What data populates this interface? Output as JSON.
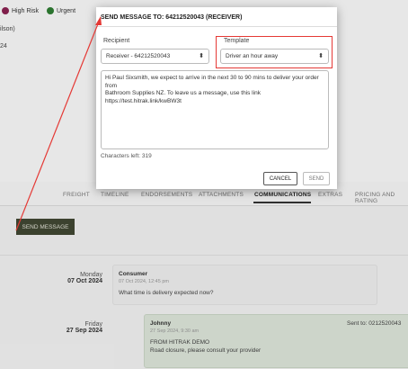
{
  "background": {
    "badges": [
      {
        "label": "High Risk",
        "color": "#8b2252"
      },
      {
        "label": "Urgent",
        "color": "#2e7d32"
      }
    ],
    "left_fragments": [
      "ilson)",
      "24"
    ],
    "tabs": [
      "FREIGHT",
      "TIMELINE",
      "ENDORSEMENTS",
      "ATTACHMENTS",
      "COMMUNICATIONS",
      "EXTRAS",
      "PRICING AND RATING"
    ],
    "active_tab": "COMMUNICATIONS",
    "send_message_button": "SEND MESSAGE",
    "messages": [
      {
        "day": "Monday",
        "date": "07 Oct 2024",
        "sender": "Consumer",
        "time": "07 Oct 2024, 12:45 pm",
        "text": "What time is delivery expected now?"
      },
      {
        "day": "Friday",
        "date": "27 Sep 2024",
        "sender": "Johnny",
        "time": "27 Sep 2024, 9:30 am",
        "sent_to": "Sent to: 0212520043",
        "text": "FROM HITRAK DEMO",
        "text2": "Road closure, please consult your provider"
      }
    ]
  },
  "modal": {
    "title": "SEND MESSAGE TO: 64212520043 (RECEIVER)",
    "recipient_label": "Recipient",
    "recipient_value": "Receiver - 64212520043",
    "template_label": "Template",
    "template_value": "Driver an hour away",
    "message_line1": "Hi Paul Sixsmith, we expect to arrive in the next 30 to 90 mins to deliver your order from",
    "message_line2": "Bathroom Supplies NZ. To leave us a message, use this link",
    "message_line3": "https://test.hitrak.link/kwBW3t",
    "characters_left": "Characters left: 319",
    "cancel_label": "CANCEL",
    "send_label": "SEND"
  },
  "colors": {
    "annotation_red": "#e53935",
    "send_button_bg": "#424834"
  }
}
